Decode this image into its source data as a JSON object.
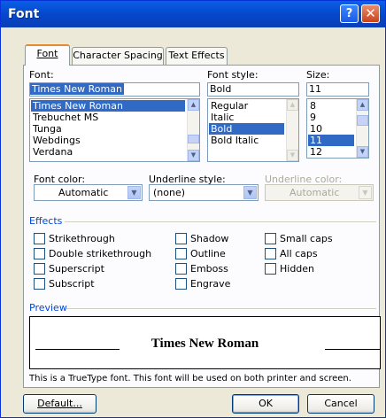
{
  "window": {
    "title": "Font",
    "help_glyph": "?",
    "close_glyph": "✕"
  },
  "tabs": [
    {
      "label": "Font",
      "active": true
    },
    {
      "label": "Character Spacing",
      "active": false
    },
    {
      "label": "Text Effects",
      "active": false
    }
  ],
  "font": {
    "label": "Font:",
    "value": "Times New Roman",
    "items": [
      "Times New Roman",
      "Trebuchet MS",
      "Tunga",
      "Webdings",
      "Verdana"
    ],
    "selected_index": 0
  },
  "font_style": {
    "label": "Font style:",
    "value": "Bold",
    "items": [
      "Regular",
      "Italic",
      "Bold",
      "Bold Italic"
    ],
    "selected_index": 2
  },
  "size": {
    "label": "Size:",
    "value": "11",
    "items": [
      "8",
      "9",
      "10",
      "11",
      "12"
    ],
    "selected_index": 3
  },
  "font_color": {
    "label": "Font color:",
    "value": "Automatic"
  },
  "underline_style": {
    "label": "Underline style:",
    "value": "(none)"
  },
  "underline_color": {
    "label": "Underline color:",
    "value": "Automatic",
    "disabled": true
  },
  "effects": {
    "label": "Effects",
    "items": [
      {
        "label": "Strikethrough",
        "checked": false
      },
      {
        "label": "Double strikethrough",
        "checked": false
      },
      {
        "label": "Superscript",
        "checked": false
      },
      {
        "label": "Subscript",
        "checked": false
      },
      {
        "label": "Shadow",
        "checked": false
      },
      {
        "label": "Outline",
        "checked": false
      },
      {
        "label": "Emboss",
        "checked": false
      },
      {
        "label": "Engrave",
        "checked": false
      },
      {
        "label": "Small caps",
        "checked": false
      },
      {
        "label": "All caps",
        "checked": false
      },
      {
        "label": "Hidden",
        "checked": false
      }
    ]
  },
  "preview": {
    "label": "Preview",
    "sample_text": "Times New Roman",
    "note": "This is a TrueType font. This font will be used on both printer and screen."
  },
  "buttons": {
    "default": "Default...",
    "ok": "OK",
    "cancel": "Cancel"
  },
  "colors": {
    "titlebar": "#0a5fe6",
    "selection": "#316ac5",
    "dialog_bg": "#ece9d8"
  }
}
